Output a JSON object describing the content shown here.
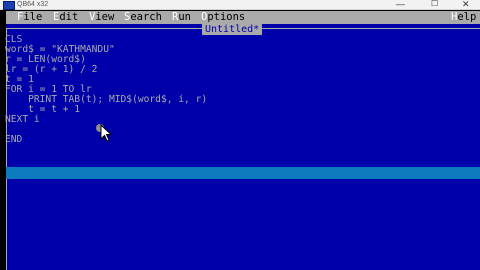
{
  "window": {
    "title": "QB64 x32",
    "minimize_glyph": "—",
    "maximize_glyph": "☐",
    "close_glyph": "✕"
  },
  "menu": {
    "items": [
      {
        "hotkey": "F",
        "rest": "ile"
      },
      {
        "hotkey": "E",
        "rest": "dit"
      },
      {
        "hotkey": "V",
        "rest": "iew"
      },
      {
        "hotkey": "S",
        "rest": "earch"
      },
      {
        "hotkey": "R",
        "rest": "un"
      },
      {
        "hotkey": "O",
        "rest": "ptions"
      },
      {
        "hotkey": "H",
        "rest": "elp"
      }
    ]
  },
  "editor": {
    "doc_title": "Untitled*",
    "lines": [
      "CLS",
      "word$ = \"KATHMANDU\"",
      "r = LEN(word$)",
      "lr = (r + 1) / 2",
      "t = 1",
      "FOR i = 1 TO lr",
      "    PRINT TAB(t); MID$(word$, i, r)",
      "    t = t + 1",
      "NEXT i",
      "",
      "END"
    ]
  },
  "colors": {
    "editor_bg": "#0000aa",
    "menu_bg": "#aaaaaa",
    "code_text": "#aaaaaa",
    "current_line": "#0c7cbf"
  },
  "icons": [
    "app-icon",
    "mouse-pointer-icon"
  ]
}
